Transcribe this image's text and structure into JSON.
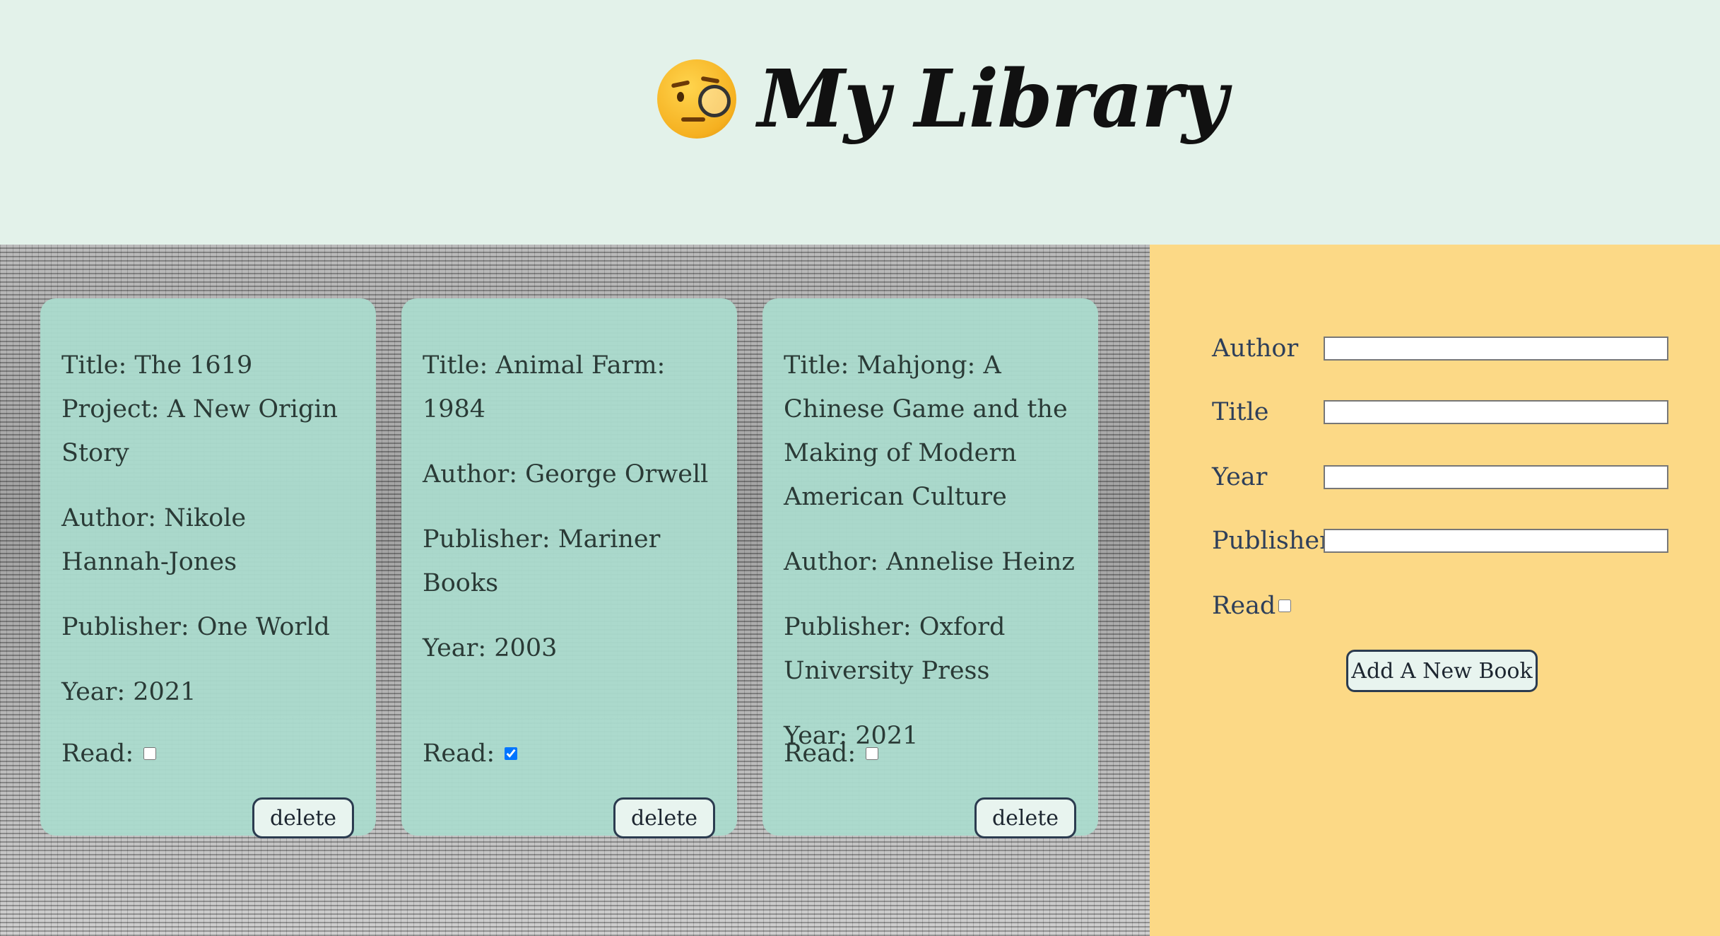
{
  "header": {
    "title": "My Library",
    "emoji_icon": "face-with-monocle-icon"
  },
  "books": [
    {
      "title": "Title: The 1619 Project: A New Origin Story",
      "author": "Author: Nikole Hannah-Jones",
      "publisher": "Publisher: One World",
      "year": "Year: 2021",
      "read_label": "Read:",
      "read": false,
      "delete_label": "delete"
    },
    {
      "title": "Title: Animal Farm: 1984",
      "author": "Author: George Orwell",
      "publisher": "Publisher: Mariner Books",
      "year": "Year: 2003",
      "read_label": "Read:",
      "read": true,
      "delete_label": "delete"
    },
    {
      "title": "Title: Mahjong: A Chinese Game and the Making of Modern American Culture",
      "author": "Author: Annelise Heinz",
      "publisher": "Publisher: Oxford University Press",
      "year": "Year: 2021",
      "read_label": "Read:",
      "read": false,
      "delete_label": "delete"
    }
  ],
  "form": {
    "author_label": "Author",
    "author_value": "",
    "title_label": "Title",
    "title_value": "",
    "year_label": "Year",
    "year_value": "",
    "publisher_label": "Publisher",
    "publisher_value": "",
    "read_label": "Read",
    "read_checked": false,
    "submit_label": "Add A New Book"
  },
  "colors": {
    "header_bg": "#e3f2ea",
    "card_bg": "#abdbce",
    "form_bg": "#fcd986",
    "label_color": "#2e3f5a"
  }
}
